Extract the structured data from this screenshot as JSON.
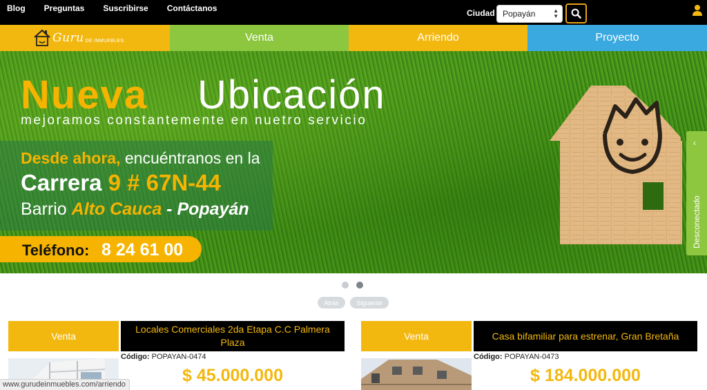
{
  "topnav": {
    "items": [
      "Blog",
      "Preguntas",
      "Suscribirse",
      "Contáctanos"
    ],
    "city_label": "Ciudad",
    "city_selected": "Popayán"
  },
  "logo": {
    "main": "Guru",
    "sub": "DE INMUEBLES"
  },
  "mainnav": {
    "venta": "Venta",
    "arriendo": "Arriendo",
    "proyecto": "Proyecto"
  },
  "banner": {
    "title_bold": "Nueva",
    "title_light": "Ubicación",
    "subtitle": "mejoramos constantemente en nuetro servicio",
    "line1_a": "Desde ",
    "line1_b": "ahora,",
    "line1_c": " encuéntranos en la",
    "line2_a": "Carrera ",
    "line2_b": "9 # 67N-44",
    "line3_a": "Barrio ",
    "line3_b": "Alto Cauca",
    "line3_c": " - Popayán",
    "phone_label": "Teléfono:",
    "phone_number": "8 24 61 00"
  },
  "side_tab": {
    "label": "Desconectado"
  },
  "carousel": {
    "prev": "Atrás",
    "next": "Siguiente"
  },
  "listings": [
    {
      "operation": "Venta",
      "title": "Locales Comerciales 2da Etapa C.C Palmera Plaza",
      "code_label": "Código:",
      "code": "POPAYAN-0474",
      "price": "$ 45.000.000"
    },
    {
      "operation": "Venta",
      "title": "Casa bifamiliar para estrenar, Gran Bretaña",
      "code_label": "Código:",
      "code": "POPAYAN-0473",
      "price": "$ 184.000.000"
    }
  ],
  "status_url": "www.gurudeinmuebles.com/arriendo",
  "colors": {
    "yellow": "#f3b80f",
    "green": "#8dc63f",
    "blue": "#3aa9e0",
    "black": "#000000"
  },
  "icons": {
    "search": "search-icon",
    "user": "user-icon",
    "chevron": "chevron-left-icon"
  }
}
